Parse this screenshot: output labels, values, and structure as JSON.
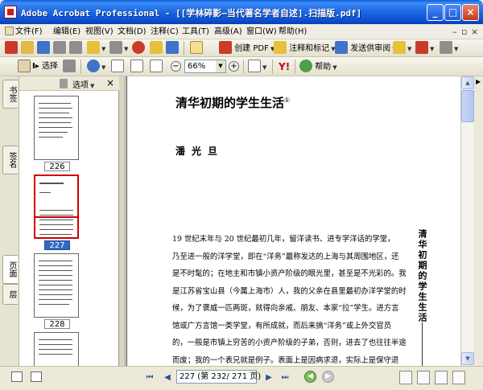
{
  "window": {
    "title": "Adobe Acrobat Professional - [[学林碎影—当代著名学者自述].扫描版.pdf]",
    "controls": {
      "minimize": "_",
      "maximize": "□",
      "close": "×"
    }
  },
  "menu": [
    {
      "label": "文件(F)"
    },
    {
      "label": "编辑(E)"
    },
    {
      "label": "视图(V)"
    },
    {
      "label": "文档(D)"
    },
    {
      "label": "注释(C)"
    },
    {
      "label": "工具(T)"
    },
    {
      "label": "高级(A)"
    },
    {
      "label": "窗口(W)"
    },
    {
      "label": "帮助(H)"
    }
  ],
  "toolbar1": {
    "create_pdf": "创建 PDF",
    "comment_markup": "注释和标记",
    "send_review": "发送供审阅"
  },
  "toolbar2": {
    "select": "选择",
    "zoom": "66%",
    "help": "帮助",
    "yahoo": "Y!"
  },
  "left_tabs": [
    "书签",
    "签名",
    "页面",
    "层"
  ],
  "thumb_panel": {
    "options": "选项",
    "close": "×",
    "pages": [
      {
        "label": "226",
        "selected": false
      },
      {
        "label": "227",
        "selected": true
      },
      {
        "label": "228",
        "selected": false
      }
    ]
  },
  "document": {
    "title": "清华初期的学生生活",
    "footnote": "①",
    "author": "潘光旦",
    "body": [
      "19 世纪末年与 20 世纪最初几年，留洋读书、进专学洋话的学堂，",
      "乃至进一般的洋学堂，即在“洋务”最称发达的上海与其周围地区，还",
      "是不时髦的；在地主和市镇小资产阶级的眼光里，甚至是不光彩的。我",
      "是江苏省宝山县（今属上海市）人，我的父亲在县里最初办洋学堂的时",
      "候，为了褒威一匹两斑，就得向亲戚、朋友、本家“拉”学生。进方言",
      "馆或广方言馆一类学堂，有所成就，而后来搞“洋务”或上外交官员",
      "的，一般是市镇上穷苦的小资产阶级的子弟，否则，进去了也往往半途",
      "而废；我的一个表兄就是例子。表面上是因病求退，实际上是保守退"
    ],
    "side_heading": "清华初期的学生生活"
  },
  "statusbar": {
    "page_field": "227 (第 232/ 271 页)"
  }
}
